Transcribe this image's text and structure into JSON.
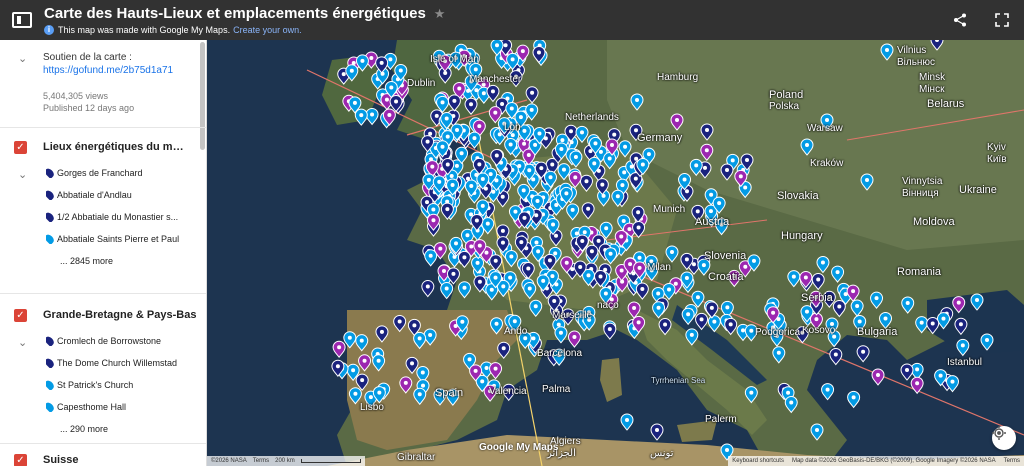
{
  "header": {
    "title": "Carte des Hauts-Lieux et emplacements énergétiques",
    "subtitle": "This map was made with Google My Maps.",
    "create_link": "Create your own."
  },
  "about": {
    "support": "Soutien de la carte :",
    "link": "https://gofund.me/2b75d1a71",
    "views": "5,404,305 views",
    "published": "Published 12 days ago"
  },
  "layers": [
    {
      "title": "Lieux énergétiques du mon...",
      "places": [
        {
          "name": "Gorges de Franchard",
          "color": "dark"
        },
        {
          "name": "Abbatiale d'Andlau",
          "color": "dark"
        },
        {
          "name": "1/2 Abbatiale du Monastier s...",
          "color": "dark"
        },
        {
          "name": "Abbatiale Saints Pierre et Paul",
          "color": "light"
        }
      ],
      "more": "... 2845 more"
    },
    {
      "title": "Grande-Bretagne & Pays-Bas",
      "places": [
        {
          "name": "Cromlech de Borrowstone",
          "color": "dark"
        },
        {
          "name": "The Dome Church Willemstad",
          "color": "dark"
        },
        {
          "name": "St Patrick's Church",
          "color": "light"
        },
        {
          "name": "Capesthome Hall",
          "color": "light"
        }
      ],
      "more": "... 290 more"
    },
    {
      "title": "Suisse",
      "places": [],
      "more": ""
    }
  ],
  "map": {
    "labels": {
      "vilnius": "Vilnius",
      "vilnius_cyr": "Вільнюс",
      "minsk": "Minsk",
      "minsk_cyr": "Мінск",
      "belarus": "Belarus",
      "hamburg": "Hamburg",
      "poland": "Poland",
      "polska": "Polska",
      "warsaw": "Warsaw",
      "netherlands": "Netherlands",
      "germany": "Germany",
      "kyiv": "Kyiv",
      "kyiv_cyr": "Київ",
      "krakow": "Kraków",
      "slovakia": "Slovakia",
      "ukraine": "Ukraine",
      "vinnytsia": "Vinnytsia",
      "vinnytsia_cyr": "Вінниця",
      "munich": "Munich",
      "austria": "Austria",
      "moldova": "Moldova",
      "hungary": "Hungary",
      "milan": "Milan",
      "slovenia": "Slovenia",
      "croatia": "Croatia",
      "romania": "Romania",
      "serbia": "Serbia",
      "bulgaria": "Bulgaria",
      "kosovo": "Kosovo",
      "podgorica": "Podgorica",
      "istanbul": "Istanbul",
      "manchester": "Manchester",
      "dublin": "Dublin",
      "isle_of_man": "Isle of Man",
      "london": "Lon",
      "monaco": "naco",
      "marseille": "Marseille",
      "barcelona": "Barcelona",
      "andorra": "Ando",
      "spain": "Spain",
      "valencia": "Valencia",
      "palma": "Palma",
      "lisbon": "Lisbo",
      "gibraltar": "Gibraltar",
      "algiers": "Algiers",
      "algiers_ar": "الجزائر",
      "tunis": "تونس",
      "tyrrhenian": "Tyrrhenian Sea",
      "palermo": "Palerm"
    },
    "logo": "Google My Maps",
    "footer_left": [
      "©2026 NASA",
      "Terms",
      "200 km"
    ],
    "footer_right": [
      "Keyboard shortcuts",
      "Map data ©2026 GeoBasis-DE/BKG (©2009), Google Imagery ©2026 NASA",
      "Terms"
    ]
  },
  "icons": {
    "map": "map-icon",
    "star": "star-icon",
    "share": "share-icon",
    "fullscreen": "fullscreen-icon",
    "info": "info-icon",
    "locate": "locate-icon"
  }
}
